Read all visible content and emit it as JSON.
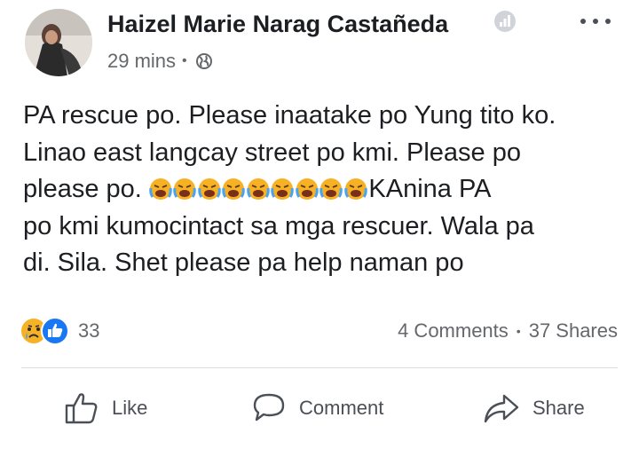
{
  "post": {
    "author": "Haizel Marie Narag Castañeda",
    "time": "29 mins",
    "meta_separator": "•",
    "text_lines": [
      "PA rescue po. Please inaatake po Yung tito ko.",
      "Linao east langcay street po kmi. Please po",
      "please po.",
      "KAnina PA",
      "po kmi kumocintact sa mga rescuer. Wala pa",
      "di. Sila. Shet please pa help naman po"
    ],
    "emoji_count": 9,
    "emoji_icon": "crying-loudly-face-emoji"
  },
  "engagement": {
    "reaction_icons": [
      "sad-reaction-icon",
      "like-reaction-icon"
    ],
    "reaction_count": "33",
    "comments": "4 Comments",
    "separator": "•",
    "shares": "37 Shares"
  },
  "actions": {
    "like_label": "Like",
    "comment_label": "Comment",
    "share_label": "Share"
  },
  "colors": {
    "text": "#1c1e21",
    "secondary": "#65676b",
    "like_blue": "#1877f2",
    "sad_yellow": "#f7b125",
    "divider": "#dadde1"
  }
}
